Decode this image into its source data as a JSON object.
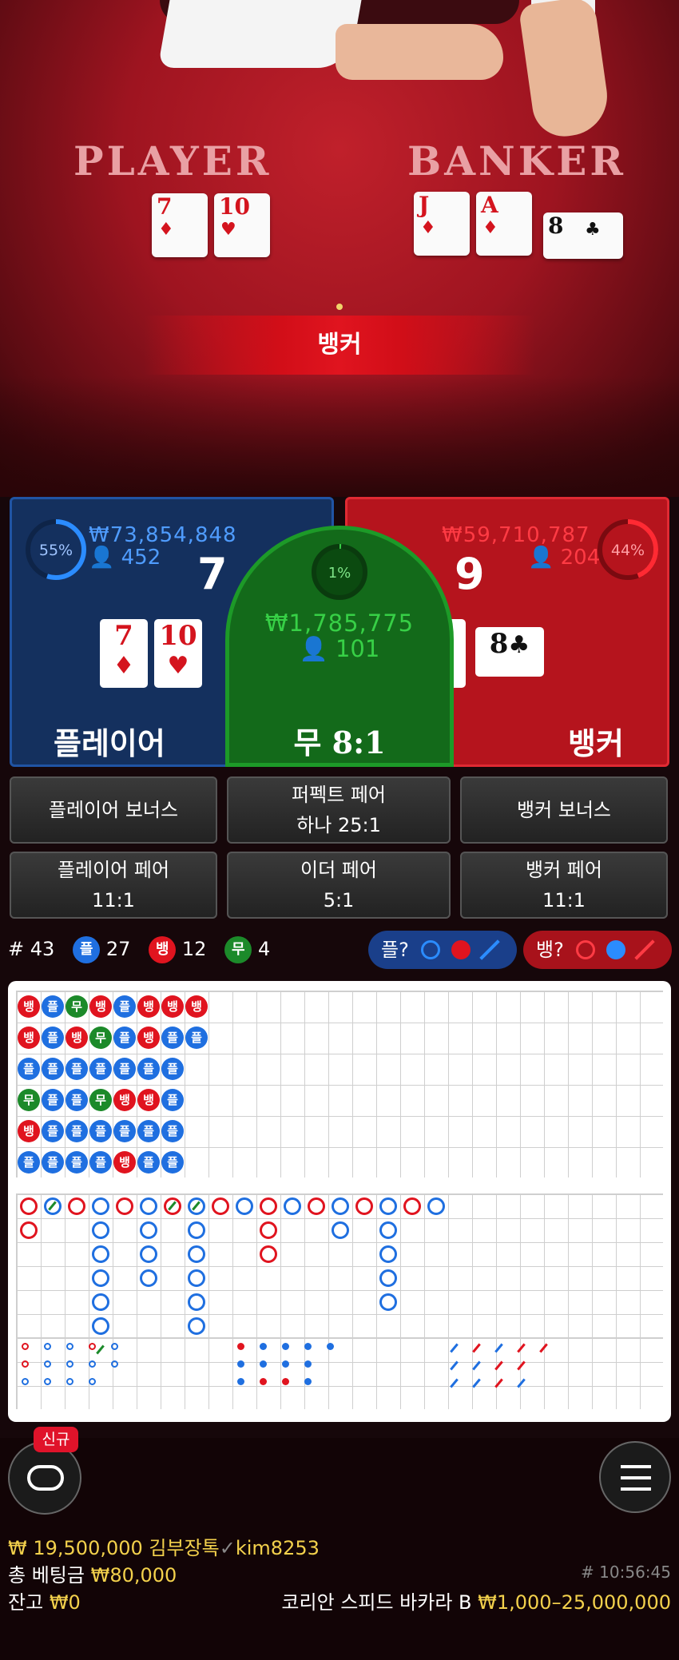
{
  "video": {
    "table_labels": {
      "player": "PLAYER",
      "banker": "BANKER"
    },
    "player_cards": [
      {
        "rank": "7",
        "suit": "♦",
        "color": "red"
      },
      {
        "rank": "10",
        "suit": "♥",
        "color": "red"
      }
    ],
    "banker_cards": [
      {
        "rank": "J",
        "suit": "♦",
        "color": "red"
      },
      {
        "rank": "A",
        "suit": "♦",
        "color": "red"
      },
      {
        "rank": "8",
        "suit": "♣",
        "color": "black"
      }
    ],
    "result_banner": "뱅커"
  },
  "player_panel": {
    "percent": "55%",
    "percent_value": 55,
    "amount": "₩73,854,848",
    "bettors": "452",
    "score": "7",
    "label": "플레이어",
    "cards": [
      {
        "rank": "7",
        "suit": "♦"
      },
      {
        "rank": "10",
        "suit": "♥"
      }
    ]
  },
  "tie_panel": {
    "percent": "1%",
    "percent_value": 1,
    "amount": "₩1,785,775",
    "bettors": "101",
    "label": "무",
    "payout": "8:1"
  },
  "banker_panel": {
    "percent": "44%",
    "percent_value": 44,
    "amount": "₩59,710,787",
    "bettors": "204",
    "score": "9",
    "label": "뱅커",
    "cards": [
      {
        "rank": "J",
        "suit": "♦"
      },
      {
        "rank": "A",
        "suit": "♦"
      },
      {
        "rank": "8",
        "suit": "♣"
      }
    ]
  },
  "side_bets": {
    "player_bonus": "플레이어 보너스",
    "perfect_pair": "퍼펙트 페어",
    "perfect_pair_odds": "하나 25:1",
    "banker_bonus": "뱅커 보너스",
    "player_pair": "플레이어 페어",
    "player_pair_odds": "11:1",
    "either_pair": "이더 페어",
    "either_pair_odds": "5:1",
    "banker_pair": "뱅커 페어",
    "banker_pair_odds": "11:1"
  },
  "stats": {
    "round": "# 43",
    "player_icon": "플",
    "player_count": "27",
    "banker_icon": "뱅",
    "banker_count": "12",
    "tie_icon": "무",
    "tie_count": "4",
    "player_ask": "플?",
    "banker_ask": "뱅?"
  },
  "bead_road": [
    [
      "뱅",
      "플",
      "무",
      "뱅",
      "플",
      "뱅",
      "뱅",
      "뱅"
    ],
    [
      "뱅",
      "플",
      "뱅",
      "무",
      "플",
      "뱅",
      "플",
      "플"
    ],
    [
      "플",
      "플",
      "플",
      "플",
      "플",
      "플",
      "플"
    ],
    [
      "무",
      "플",
      "플",
      "무",
      "뱅",
      "뱅",
      "플"
    ],
    [
      "뱅",
      "플",
      "플",
      "플",
      "플",
      "플",
      "플"
    ],
    [
      "플",
      "플",
      "플",
      "플",
      "뱅",
      "플",
      "플"
    ]
  ],
  "footer": {
    "chat_icon": "chat-bubble-icon",
    "new_badge": "신규",
    "menu_icon": "hamburger-menu-icon",
    "balance_top": "₩ 19,500,000",
    "username": "김부장톡",
    "user_id": "kim8253",
    "total_bet_label": "총 베팅금",
    "total_bet": "₩80,000",
    "game_id": "# 10:56:45",
    "balance_label": "잔고",
    "balance": "₩0",
    "table_name": "코리안 스피드 바카라 B",
    "limits": "₩1,000–25,000,000"
  },
  "colors": {
    "player": "#1f6fe0",
    "banker": "#e0141f",
    "tie": "#1c8a2a",
    "gold": "#f3d14c"
  }
}
